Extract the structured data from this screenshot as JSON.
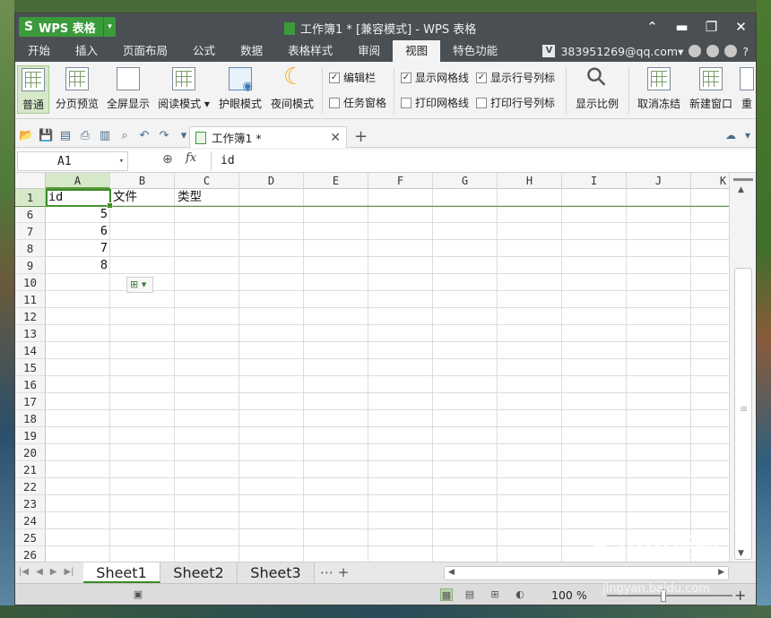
{
  "app": {
    "name": "WPS 表格",
    "window_title": "工作簿1 * [兼容模式] - WPS 表格"
  },
  "menu": [
    "开始",
    "插入",
    "页面布局",
    "公式",
    "数据",
    "表格样式",
    "审阅",
    "视图",
    "特色功能"
  ],
  "menu_active": "视图",
  "account": {
    "badge": "V",
    "email": "383951269@qq.com▾",
    "help": "?"
  },
  "ribbon": {
    "buttons": [
      {
        "label": "普通",
        "icon": "grid-icon",
        "active": true
      },
      {
        "label": "分页预览",
        "icon": "page-break-icon"
      },
      {
        "label": "全屏显示",
        "icon": "fullscreen-icon"
      },
      {
        "label": "阅读模式 ▾",
        "icon": "reading-icon"
      },
      {
        "label": "护眼模式",
        "icon": "eye-icon"
      },
      {
        "label": "夜间模式",
        "icon": "moon-icon"
      }
    ],
    "checks": [
      {
        "label": "编辑栏",
        "checked": true
      },
      {
        "label": "任务窗格",
        "checked": false
      },
      {
        "label": "显示网格线",
        "checked": true
      },
      {
        "label": "显示行号列标",
        "checked": true
      },
      {
        "label": "打印网格线",
        "checked": false
      },
      {
        "label": "打印行号列标",
        "checked": false
      }
    ],
    "zoom_label": "显示比例",
    "unfreeze_label": "取消冻结",
    "new_window_label": "新建窗口",
    "cut_label": "重"
  },
  "doc_tab": {
    "label": "工作簿1 *"
  },
  "formula_bar": {
    "name_box": "A1",
    "fx": "fx",
    "value": "id"
  },
  "columns": [
    "A",
    "B",
    "C",
    "D",
    "E",
    "F",
    "G",
    "H",
    "I",
    "J",
    "K"
  ],
  "rows": [
    "1",
    "6",
    "7",
    "8",
    "9",
    "10",
    "11",
    "12",
    "13",
    "14",
    "15",
    "16",
    "17",
    "18",
    "19",
    "20",
    "21",
    "22",
    "23",
    "24",
    "25",
    "26"
  ],
  "cells": {
    "A1": "id",
    "B1": "文件",
    "C1": "类型",
    "A6": "5",
    "A7": "6",
    "A8": "7",
    "A9": "8"
  },
  "sheets": [
    "Sheet1",
    "Sheet2",
    "Sheet3"
  ],
  "active_sheet": "Sheet1",
  "status": {
    "zoom": "100 %"
  },
  "watermark": {
    "brand": "Baidu经验",
    "url": "jingyan.baidu.com"
  },
  "colors": {
    "accent": "#3a8a2a",
    "titlebar": "#4a4f54",
    "selected_header": "#d5e8c8"
  }
}
